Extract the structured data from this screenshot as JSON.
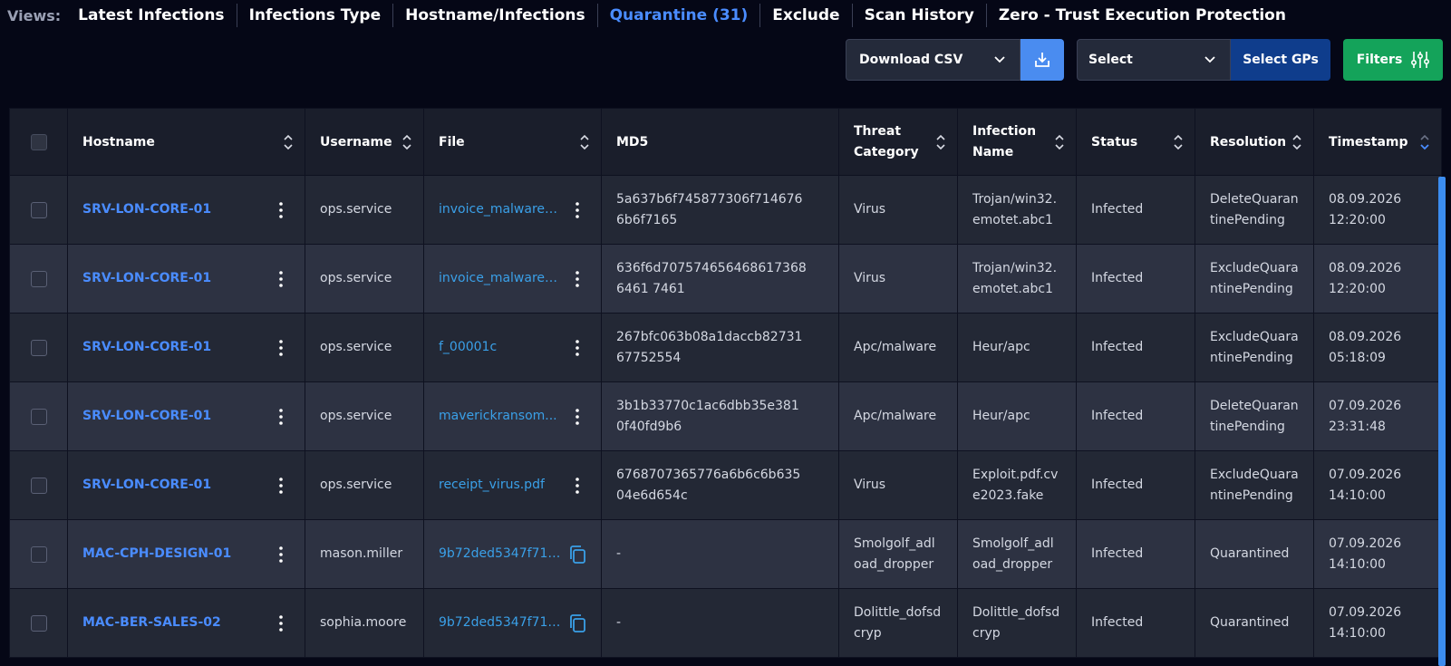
{
  "views": {
    "label": "Views:",
    "tabs": [
      {
        "label": "Latest Infections",
        "active": false
      },
      {
        "label": "Infections Type",
        "active": false
      },
      {
        "label": "Hostname/Infections",
        "active": false
      },
      {
        "label": "Quarantine (31)",
        "active": true
      },
      {
        "label": "Exclude",
        "active": false
      },
      {
        "label": "Scan History",
        "active": false
      },
      {
        "label": "Zero - Trust Execution Protection",
        "active": false
      }
    ]
  },
  "toolbar": {
    "download_label": "Download CSV",
    "group_select_value": "Select",
    "select_gps_label": "Select GPs",
    "filters_label": "Filters"
  },
  "table": {
    "columns": [
      "Hostname",
      "Username",
      "File",
      "MD5",
      "Threat Category",
      "Infection Name",
      "Status",
      "Resolution",
      "Timestamp"
    ],
    "rows": [
      {
        "hostname": "SRV-LON-CORE-01",
        "username": "ops.service",
        "file": "invoice_malware_...",
        "file_icon": "kebab-icon",
        "md5": "5a637b6f745877306f7146766b6f7165",
        "threat": "Virus",
        "infection": "Trojan/win32.emotet.abc1",
        "status": "Infected",
        "resolution": "DeleteQuarantinePending",
        "timestamp_date": "08.09.2026",
        "timestamp_time": "12:20:00"
      },
      {
        "hostname": "SRV-LON-CORE-01",
        "username": "ops.service",
        "file": "invoice_malware_...",
        "file_icon": "kebab-icon",
        "md5": "636f6d7075746564686173686461 7461",
        "threat": "Virus",
        "infection": "Trojan/win32.emotet.abc1",
        "status": "Infected",
        "resolution": "ExcludeQuarantinePending",
        "timestamp_date": "08.09.2026",
        "timestamp_time": "12:20:00"
      },
      {
        "hostname": "SRV-LON-CORE-01",
        "username": "ops.service",
        "file": "f_00001c",
        "file_icon": "kebab-icon",
        "md5": "267bfc063b08a1daccb8273167752554",
        "threat": "Apc/malware",
        "infection": "Heur/apc",
        "status": "Infected",
        "resolution": "ExcludeQuarantinePending",
        "timestamp_date": "08.09.2026",
        "timestamp_time": "05:18:09"
      },
      {
        "hostname": "SRV-LON-CORE-01",
        "username": "ops.service",
        "file": "maverickransom...",
        "file_icon": "kebab-icon",
        "md5": "3b1b33770c1ac6dbb35e3810f40fd9b6",
        "threat": "Apc/malware",
        "infection": "Heur/apc",
        "status": "Infected",
        "resolution": "DeleteQuarantinePending",
        "timestamp_date": "07.09.2026",
        "timestamp_time": "23:31:48"
      },
      {
        "hostname": "SRV-LON-CORE-01",
        "username": "ops.service",
        "file": "receipt_virus.pdf",
        "file_icon": "kebab-icon",
        "md5": "6768707365776a6b6c6b63504e6d654c",
        "threat": "Virus",
        "infection": "Exploit.pdf.cve2023.fake",
        "status": "Infected",
        "resolution": "ExcludeQuarantinePending",
        "timestamp_date": "07.09.2026",
        "timestamp_time": "14:10:00"
      },
      {
        "hostname": "MAC-CPH-DESIGN-01",
        "username": "mason.miller",
        "file": "9b72ded5347f718...",
        "file_icon": "copy-icon",
        "md5": "-",
        "threat": "Smolgolf_adload_dropper",
        "infection": "Smolgolf_adload_dropper",
        "status": "Infected",
        "resolution": "Quarantined",
        "timestamp_date": "07.09.2026",
        "timestamp_time": "14:10:00"
      },
      {
        "hostname": "MAC-BER-SALES-02",
        "username": "sophia.moore",
        "file": "9b72ded5347f718...",
        "file_icon": "copy-icon",
        "md5": "-",
        "threat": "Dolittle_dofsdcryp",
        "infection": "Dolittle_dofsdcryp",
        "status": "Infected",
        "resolution": "Quarantined",
        "timestamp_date": "07.09.2026",
        "timestamp_time": "14:10:00"
      }
    ]
  },
  "colors": {
    "accent": "#4a8cff",
    "download": "#4a8cf0",
    "select_gps": "#0f3d8c",
    "filters": "#14a35a"
  }
}
